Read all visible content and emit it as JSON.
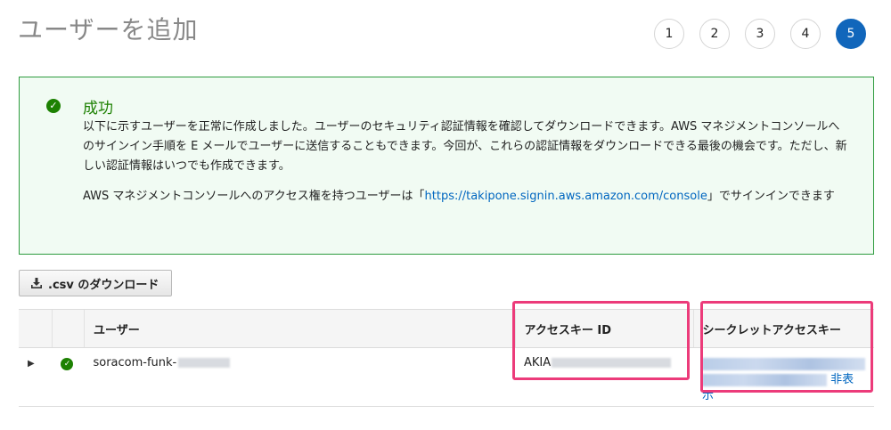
{
  "page": {
    "title": "ユーザーを追加",
    "steps": [
      "1",
      "2",
      "3",
      "4",
      "5"
    ],
    "active_step": "5"
  },
  "alert": {
    "icon": "check-circle-icon",
    "title": "成功",
    "body_p1": "以下に示すユーザーを正常に作成しました。ユーザーのセキュリティ認証情報を確認してダウンロードできます。AWS マネジメントコンソールへのサインイン手順を E メールでユーザーに送信することもできます。今回が、これらの認証情報をダウンロードできる最後の機会です。ただし、新しい認証情報はいつでも作成できます。",
    "body_p2_prefix": "AWS マネジメントコンソールへのアクセス権を持つユーザーは「",
    "console_url": "https://takipone.signin.aws.amazon.com/console",
    "body_p2_suffix": "」でサインインできます",
    "border_color": "#2d9b3e",
    "background_color": "#f1fbf3"
  },
  "toolbar": {
    "download_icon": "download-icon",
    "download_csv_label": ".csv のダウンロード"
  },
  "table": {
    "headers": {
      "user": "ユーザー",
      "access_key_id": "アクセスキー ID",
      "secret_access_key": "シークレットアクセスキー"
    },
    "rows": [
      {
        "user_name": "soracom-funk-",
        "access_key_prefix": "AKIA",
        "hide_label": "非表示"
      }
    ]
  },
  "colors": {
    "accent": "#1166bb",
    "success": "#1d8102",
    "link": "#0066c0",
    "highlight": "#ec3b7a"
  }
}
